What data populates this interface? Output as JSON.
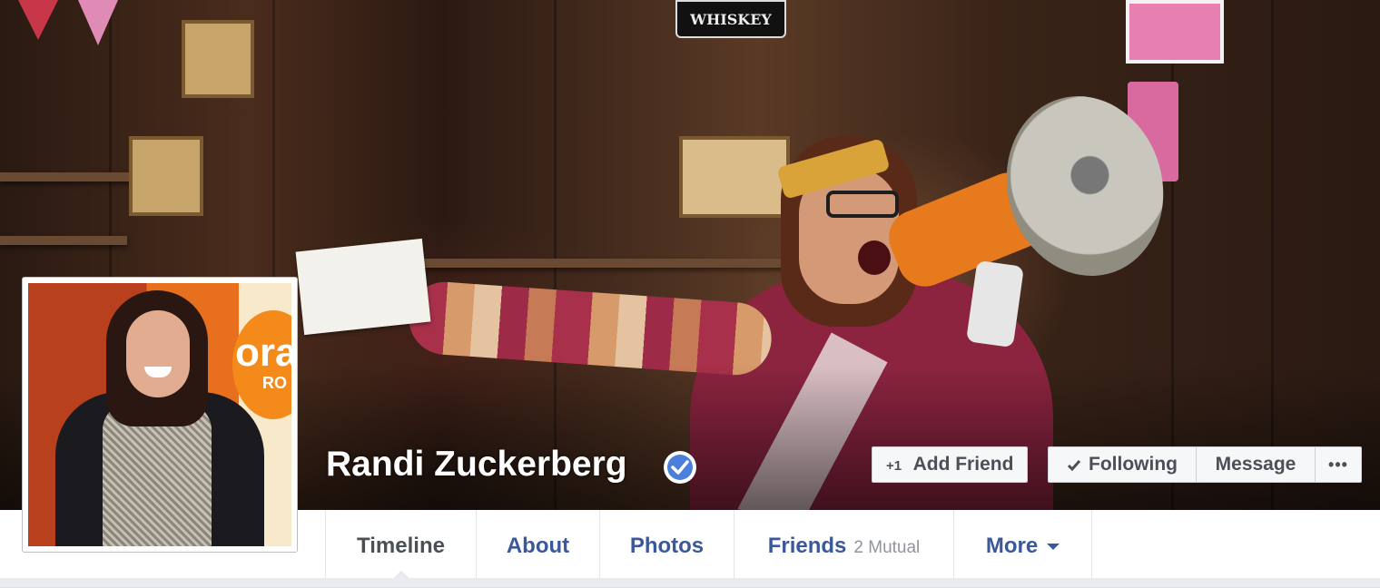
{
  "profile": {
    "name": "Randi Zuckerberg",
    "verified": true,
    "profile_picture_logo_text": "ora",
    "profile_picture_logo_subtext": "RO"
  },
  "cover": {
    "sign_text": "WHISKEY"
  },
  "actions": {
    "add_friend_label": "Add Friend",
    "following_label": "Following",
    "message_label": "Message",
    "more_label": "•••"
  },
  "tabs": [
    {
      "label": "Timeline",
      "active": true
    },
    {
      "label": "About"
    },
    {
      "label": "Photos"
    },
    {
      "label": "Friends",
      "sub": "2 Mutual"
    },
    {
      "label": "More"
    }
  ],
  "colors": {
    "link_blue": "#3b5998",
    "verified_blue": "#4b7fdc",
    "button_bg": "#f6f7f9",
    "page_bg": "#e9ebee"
  },
  "icons": {
    "verified": "verified-check-icon",
    "add_friend": "add-friend-icon",
    "following": "checkmark-icon",
    "more": "ellipsis-icon",
    "tab_more": "caret-down-icon"
  }
}
